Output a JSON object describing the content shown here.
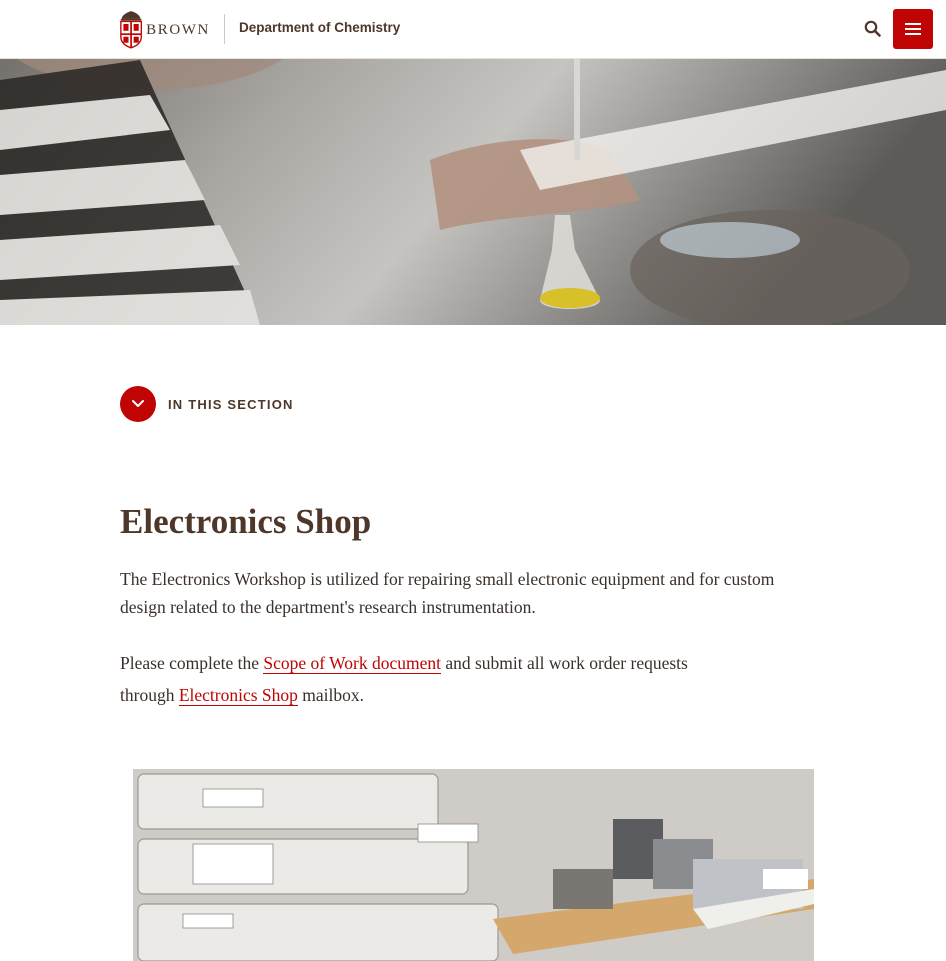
{
  "header": {
    "brand_wordmark": "BROWN",
    "department": "Department of Chemistry"
  },
  "section_nav": {
    "label": "IN THIS SECTION"
  },
  "main": {
    "title": "Electronics Shop",
    "intro": "The Electronics Workshop is utilized for repairing small electronic equipment and for custom design related to the department's research instrumentation.",
    "para2": {
      "before": "Please complete the ",
      "link1": "Scope of Work document",
      "middle": " and submit all work order requests through ",
      "link2": "Electronics Shop",
      "after": " mailbox."
    }
  },
  "colors": {
    "brand_red": "#c00404",
    "brand_brown": "#4e3629"
  },
  "icons": {
    "search": "search-icon",
    "menu": "menu-icon",
    "chevron": "chevron-down-icon",
    "shield": "brown-shield-icon"
  }
}
